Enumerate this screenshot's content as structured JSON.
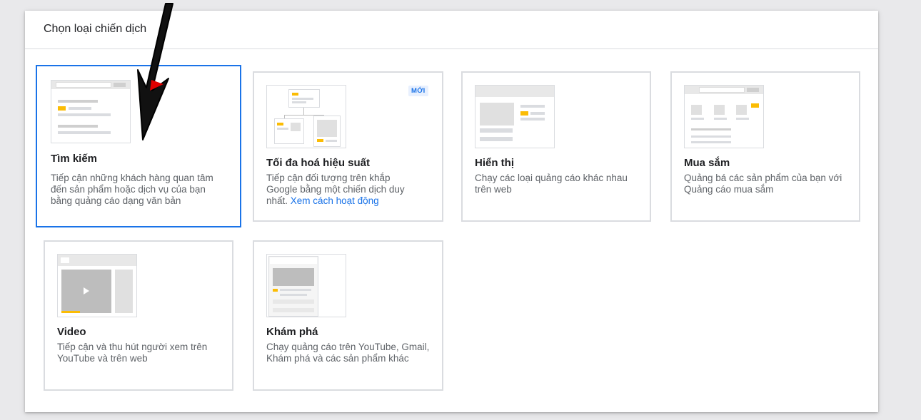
{
  "panel": {
    "title": "Chọn loại chiến dịch"
  },
  "cards": [
    {
      "title": "Tìm kiếm",
      "desc": "Tiếp cận những khách hàng quan tâm đến sản phẩm hoặc dịch vụ của bạn bằng quảng cáo dạng văn bản",
      "selected": true
    },
    {
      "title": "Tối đa hoá hiệu suất",
      "desc": "Tiếp cận đối tượng trên khắp Google bằng một chiến dịch duy nhất.",
      "link": "Xem cách hoạt động",
      "badge": "MỚI"
    },
    {
      "title": "Hiển thị",
      "desc": "Chạy các loại quảng cáo khác nhau trên web"
    },
    {
      "title": "Mua sắm",
      "desc": "Quảng bá các sản phẩm của bạn với Quảng cáo mua sắm"
    },
    {
      "title": "Video",
      "desc": "Tiếp cận và thu hút người xem trên YouTube và trên web"
    },
    {
      "title": "Khám phá",
      "desc": "Chạy quảng cáo trên YouTube, Gmail, Khám phá và các sản phẩm khác"
    }
  ],
  "colors": {
    "accent": "#1a73e8",
    "highlight": "#fbbc04",
    "arrow": "#000000",
    "arrow_fill": "#e00000"
  }
}
